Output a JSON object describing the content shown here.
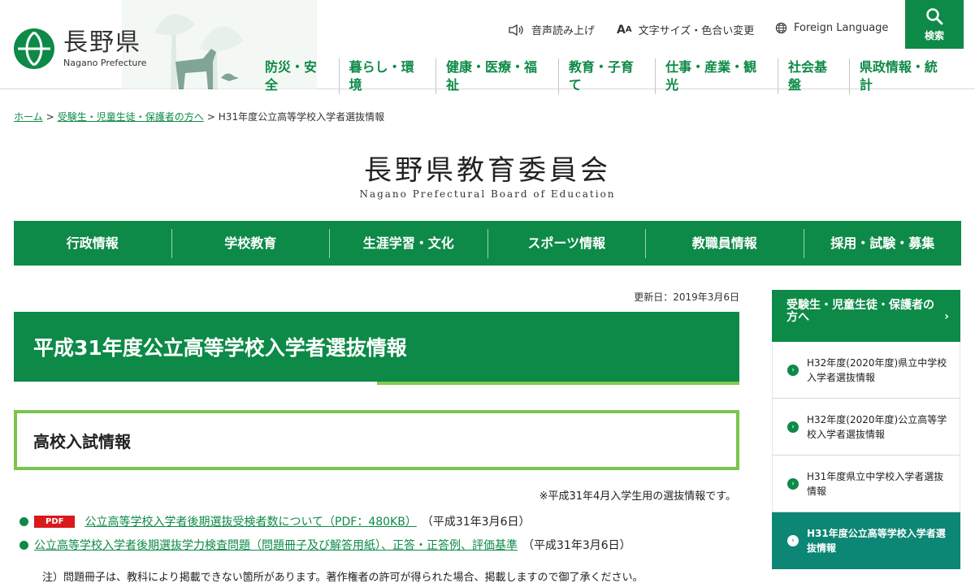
{
  "header": {
    "logo_ja": "長野県",
    "logo_en": "Nagano Prefecture",
    "utility": {
      "speech": "音声読み上げ",
      "textsize": "文字サイズ・色合い変更",
      "foreign": "Foreign Language"
    },
    "search_label": "検索",
    "gnav": [
      "防災・安全",
      "暮らし・環境",
      "健康・医療・福祉",
      "教育・子育て",
      "仕事・産業・観光",
      "社会基盤",
      "県政情報・統計"
    ]
  },
  "breadcrumb": {
    "home": "ホーム",
    "parent": "受験生・児童生徒・保護者の方へ",
    "current": "H31年度公立高等学校入学者選抜情報",
    "sep": ">"
  },
  "board": {
    "title_ja": "長野県教育委員会",
    "title_en": "Nagano Prefectural Board of Education"
  },
  "main_menu": [
    "行政情報",
    "学校教育",
    "生涯学習・文化",
    "スポーツ情報",
    "教職員情報",
    "採用・試験・募集"
  ],
  "content": {
    "updated": "更新日：2019年3月6日",
    "page_title": "平成31年度公立高等学校入学者選抜情報",
    "section_title": "高校入試情報",
    "note": "※平成31年4月入学生用の選抜情報です。",
    "links": [
      {
        "badge": "PDF",
        "text": "公立高等学校入学者後期選抜受検者数について（PDF：480KB）",
        "date": "（平成31年3月6日）"
      },
      {
        "badge": "",
        "text": "公立高等学校入学者後期選抜学力検査問題（問題冊子及び解答用紙）、正答・正答例、評価基準",
        "date": "（平成31年3月6日）"
      }
    ],
    "footnote": "注）問題冊子は、教科により掲載できない箇所があります。著作権者の許可が得られた場合、掲載しますので御了承ください。"
  },
  "sidebar": {
    "heading": "受験生・児童生徒・保護者の方へ",
    "items": [
      {
        "label": "H32年度(2020年度)県立中学校入学者選抜情報",
        "active": false
      },
      {
        "label": "H32年度(2020年度)公立高等学校入学者選抜情報",
        "active": false
      },
      {
        "label": "H31年度県立中学校入学者選抜情報",
        "active": false
      },
      {
        "label": "H31年度公立高等学校入学者選抜情報",
        "active": true
      }
    ]
  },
  "colors": {
    "brand_green": "#0d8a47",
    "light_green": "#7cc44e",
    "teal_active": "#0c8675",
    "pdf_red": "#d9191c"
  },
  "icons": {
    "logo": "nagano-logo-mark",
    "speech": "speaker-icon",
    "textsize": "font-size-icon",
    "foreign": "globe-icon",
    "search": "search-icon",
    "bullet": "bullet-icon",
    "sidebar_item": "chevron-circle-icon"
  }
}
